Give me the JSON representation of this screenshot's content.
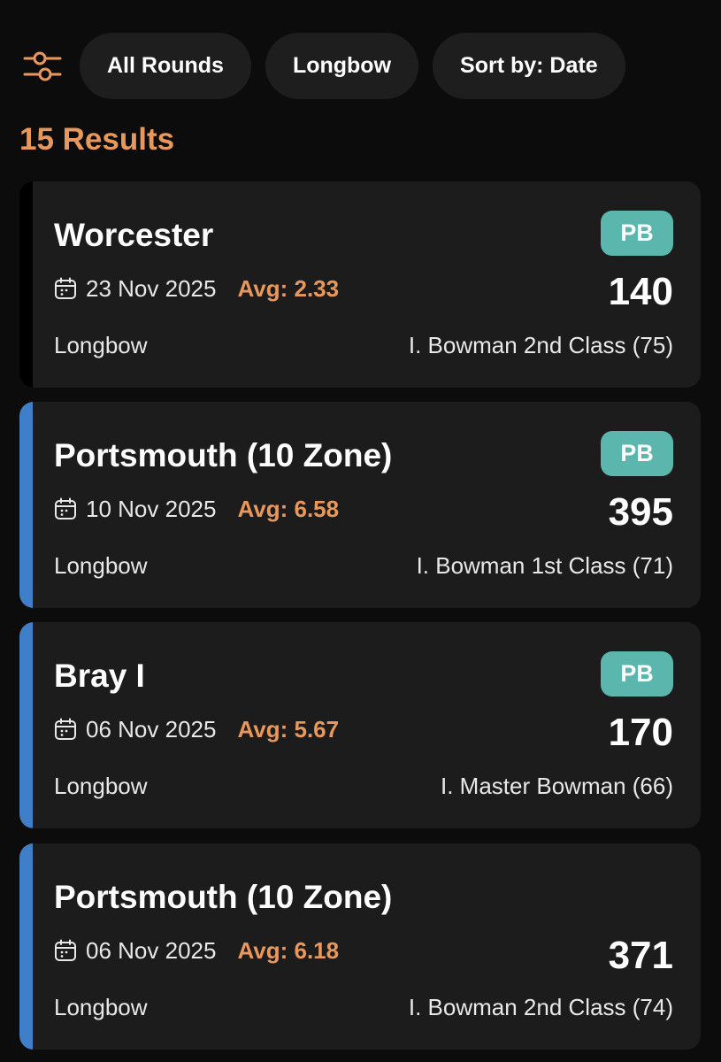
{
  "filters": {
    "icon": "sliders-icon",
    "chips": [
      {
        "label": "All Rounds"
      },
      {
        "label": "Longbow"
      },
      {
        "label": "Sort by: Date"
      }
    ]
  },
  "results": {
    "count_label": "15 Results",
    "items": [
      {
        "name": "Worcester",
        "badge": "PB",
        "date": "23 Nov 2025",
        "avg": "Avg: 2.33",
        "score": "140",
        "bow": "Longbow",
        "classification": "I. Bowman 2nd Class (75)",
        "accent_color": "#000000"
      },
      {
        "name": "Portsmouth (10 Zone)",
        "badge": "PB",
        "date": "10 Nov 2025",
        "avg": "Avg: 6.58",
        "score": "395",
        "bow": "Longbow",
        "classification": "I. Bowman 1st Class (71)",
        "accent_color": "#3f7fc7"
      },
      {
        "name": "Bray I",
        "badge": "PB",
        "date": "06 Nov 2025",
        "avg": "Avg: 5.67",
        "score": "170",
        "bow": "Longbow",
        "classification": "I. Master Bowman (66)",
        "accent_color": "#3f7fc7"
      },
      {
        "name": "Portsmouth (10 Zone)",
        "date": "06 Nov 2025",
        "avg": "Avg: 6.18",
        "score": "371",
        "bow": "Longbow",
        "classification": "I. Bowman 2nd Class (74)",
        "accent_color": "#3f7fc7"
      }
    ]
  },
  "colors": {
    "accent_orange": "#e9985b",
    "pb_badge": "#5bb6ad",
    "card_bg": "#1c1c1c",
    "chip_bg": "#1e1e1e"
  }
}
